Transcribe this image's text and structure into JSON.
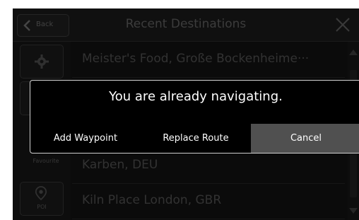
{
  "header": {
    "back_label": "Back",
    "title": "Recent Destinations"
  },
  "sidebar": {
    "favourite_label": "Favourite",
    "poi_label": "POI"
  },
  "list": {
    "rows": [
      "Meister's Food, Große Bockenheime···",
      "",
      "",
      "Karben, DEU",
      "Kiln Place London, GBR"
    ]
  },
  "dialog": {
    "message": "You are already navigating.",
    "buttons": [
      "Add Waypoint",
      "Replace Route",
      "Cancel"
    ]
  },
  "colors": {
    "dialog_border": "#d0d0d0",
    "selected_button": "#505050"
  }
}
